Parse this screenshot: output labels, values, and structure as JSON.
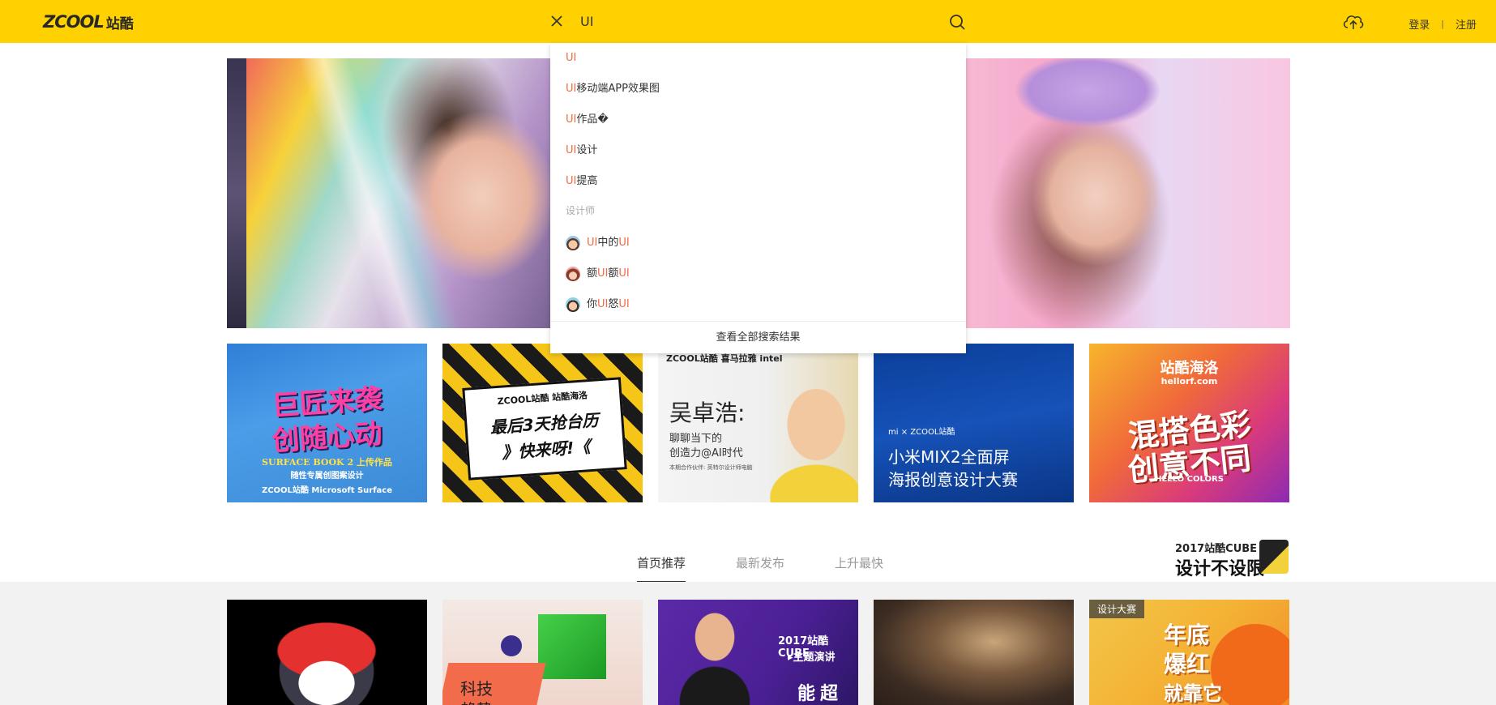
{
  "header": {
    "logo_latin": "ZCOOL",
    "logo_cjk": "站酷",
    "search_value": "UI",
    "login": "登录",
    "separator": "|",
    "register": "注册",
    "background_color": "#ffd100"
  },
  "dropdown": {
    "suggestions": [
      {
        "highlight": "UI",
        "rest": ""
      },
      {
        "highlight": "UI",
        "rest": "移动端APP效果图"
      },
      {
        "highlight": "UI",
        "rest": "作品�"
      },
      {
        "highlight": "UI",
        "rest": "设计"
      },
      {
        "highlight": "UI",
        "rest": "提高"
      }
    ],
    "designer_heading": "设计师",
    "designers": [
      {
        "p1": "UI",
        "p2": "中的",
        "p3": "UI",
        "p4": ""
      },
      {
        "p1": "额",
        "p2": "UI",
        "p3": "额",
        "p4": "UI"
      },
      {
        "p1": "你",
        "p2": "UI",
        "p3": "怒",
        "p4": "UI"
      }
    ],
    "view_all": "查看全部搜索结果",
    "highlight_color": "#ee6b41"
  },
  "banner_cards": [
    {
      "title1": "巨匠来袭",
      "title2": "创随心动",
      "sub1": "SURFACE BOOK 2 上传作品",
      "sub2": "随性专属创图案设计",
      "brand": "ZCOOL站酷 Microsoft Surface"
    },
    {
      "head": "ZCOOL站酷  站酷海洛",
      "line1": "最后3天抢台历",
      "line2": "》快来呀!《"
    },
    {
      "head": "ZCOOL站酷  喜马拉雅  intel",
      "name": "吴卓浩:",
      "desc1": "聊聊当下的",
      "desc2": "创造力@AI时代",
      "desc3": "本期合作伙伴: 英特尔设计师电脑"
    },
    {
      "badge": "mi × ZCOOL站酷",
      "line1": "小米MIX2全面屏",
      "line2": "海报创意设计大赛"
    },
    {
      "head": "站酷海洛",
      "url": "hellorf.com",
      "line1": "混搭色彩",
      "line2": "创意不同",
      "foot": "HELLO COLORS"
    }
  ],
  "tabs": [
    {
      "label": "首页推荐",
      "active": true
    },
    {
      "label": "最新发布",
      "active": false
    },
    {
      "label": "上升最快",
      "active": false
    }
  ],
  "cube_logo": {
    "top": "2017站酷CUBE",
    "bottom": "设计不设限"
  },
  "feed_cards": [
    {},
    {
      "line1": "科技",
      "line2": "趋势"
    },
    {
      "line1": "2017站酷CUBE",
      "line2": "▸主题演讲",
      "line3": "能超"
    },
    {},
    {
      "tag": "设计大赛",
      "line1": "年底",
      "line2": "爆红",
      "line3": "就靠它"
    }
  ]
}
